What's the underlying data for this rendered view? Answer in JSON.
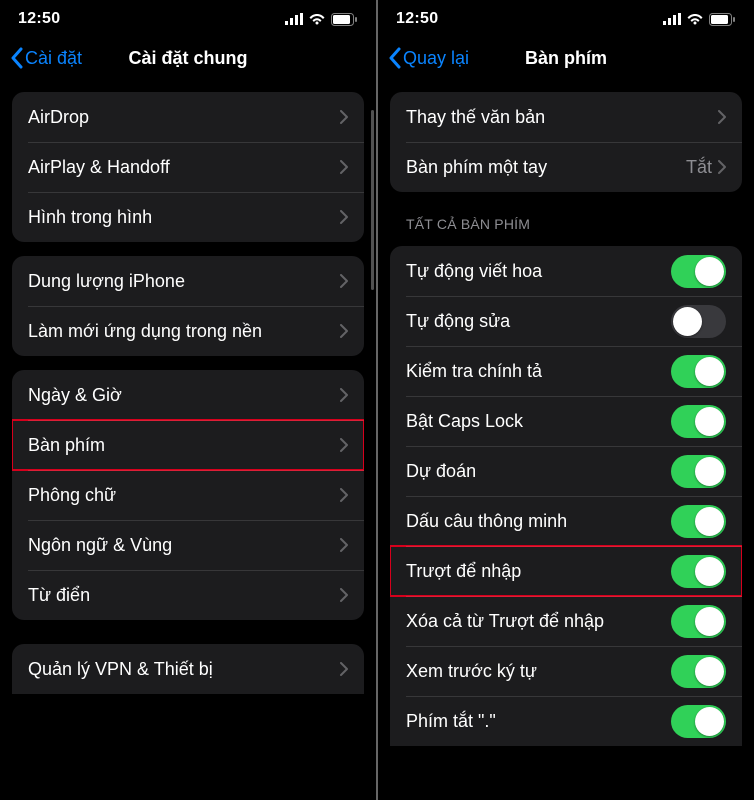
{
  "left": {
    "time": "12:50",
    "backLabel": "Cài đặt",
    "title": "Cài đặt chung",
    "g1": [
      {
        "name": "row-airdrop",
        "label": "AirDrop"
      },
      {
        "name": "row-airplay",
        "label": "AirPlay & Handoff"
      },
      {
        "name": "row-pip",
        "label": "Hình trong hình"
      }
    ],
    "g2": [
      {
        "name": "row-storage",
        "label": "Dung lượng iPhone"
      },
      {
        "name": "row-bg-refresh",
        "label": "Làm mới ứng dụng trong nền"
      }
    ],
    "g3": [
      {
        "name": "row-date-time",
        "label": "Ngày & Giờ"
      },
      {
        "name": "row-keyboard",
        "label": "Bàn phím",
        "hl": true
      },
      {
        "name": "row-fonts",
        "label": "Phông chữ"
      },
      {
        "name": "row-lang-region",
        "label": "Ngôn ngữ & Vùng"
      },
      {
        "name": "row-dictionary",
        "label": "Từ điển"
      }
    ],
    "g4": [
      {
        "name": "row-vpn",
        "label": "Quản lý VPN & Thiết bị"
      }
    ]
  },
  "right": {
    "time": "12:50",
    "backLabel": "Quay lại",
    "title": "Bàn phím",
    "top": [
      {
        "name": "row-text-replace",
        "label": "Thay thế văn bản",
        "type": "chev"
      },
      {
        "name": "row-one-hand",
        "label": "Bàn phím một tay",
        "type": "value",
        "value": "Tắt"
      }
    ],
    "groupTitle": "TẤT CẢ BÀN PHÍM",
    "toggles": [
      {
        "name": "toggle-auto-cap",
        "label": "Tự động viết hoa",
        "on": true
      },
      {
        "name": "toggle-auto-correct",
        "label": "Tự động sửa",
        "on": false
      },
      {
        "name": "toggle-spellcheck",
        "label": "Kiểm tra chính tả",
        "on": true
      },
      {
        "name": "toggle-caps-lock",
        "label": "Bật Caps Lock",
        "on": true
      },
      {
        "name": "toggle-predictive",
        "label": "Dự đoán",
        "on": true
      },
      {
        "name": "toggle-smart-punct",
        "label": "Dấu câu thông minh",
        "on": true
      },
      {
        "name": "toggle-slide-type",
        "label": "Trượt để nhập",
        "on": true,
        "hl": true
      },
      {
        "name": "toggle-delete-slide",
        "label": "Xóa cả từ Trượt để nhập",
        "on": true
      },
      {
        "name": "toggle-char-preview",
        "label": "Xem trước ký tự",
        "on": true
      },
      {
        "name": "toggle-period-shortcut",
        "label": "Phím tắt \".\"",
        "on": true
      }
    ]
  }
}
